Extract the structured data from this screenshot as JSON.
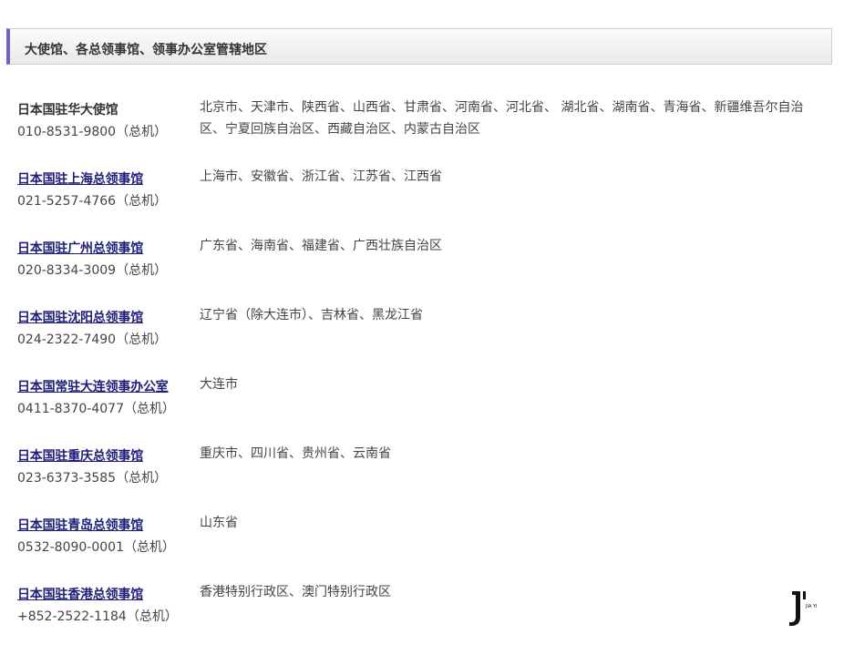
{
  "header": {
    "title": "大使馆、各总领事馆、领事办公室管辖地区"
  },
  "offices": [
    {
      "name": "日本国驻华大使馆",
      "link": false,
      "phone": "010-8531-9800（总机）",
      "jurisdiction": "北京市、天津市、陕西省、山西省、甘肃省、河南省、河北省、 湖北省、湖南省、青海省、新疆维吾尔自治区、宁夏回族自治区、西藏自治区、内蒙古自治区"
    },
    {
      "name": "日本国驻上海总领事馆",
      "link": true,
      "phone": "021-5257-4766（总机）",
      "jurisdiction": "上海市、安徽省、浙江省、江苏省、江西省"
    },
    {
      "name": "日本国驻广州总领事馆",
      "link": true,
      "phone": "020-8334-3009（总机）",
      "jurisdiction": "广东省、海南省、福建省、广西壮族自治区"
    },
    {
      "name": "日本国驻沈阳总领事馆",
      "link": true,
      "phone": "024-2322-7490（总机）",
      "jurisdiction": "辽宁省（除大连市）、吉林省、黑龙江省"
    },
    {
      "name": "日本国常驻大连领事办公室",
      "link": true,
      "phone": "0411-8370-4077（总机）",
      "jurisdiction": "大连市"
    },
    {
      "name": "日本国驻重庆总领事馆",
      "link": true,
      "phone": "023-6373-3585（总机）",
      "jurisdiction": "重庆市、四川省、贵州省、云南省"
    },
    {
      "name": "日本国驻青岛总领事馆",
      "link": true,
      "phone": "0532-8090-0001（总机）",
      "jurisdiction": "山东省"
    },
    {
      "name": "日本国驻香港总领事馆",
      "link": true,
      "phone": "+852-2522-1184（总机）",
      "jurisdiction": "香港特别行政区、澳门特别行政区"
    }
  ],
  "watermark": {
    "text": "JIA YI"
  },
  "colors": {
    "accent": "#6b63c9",
    "link": "#1f1f7a",
    "text": "#333333"
  }
}
